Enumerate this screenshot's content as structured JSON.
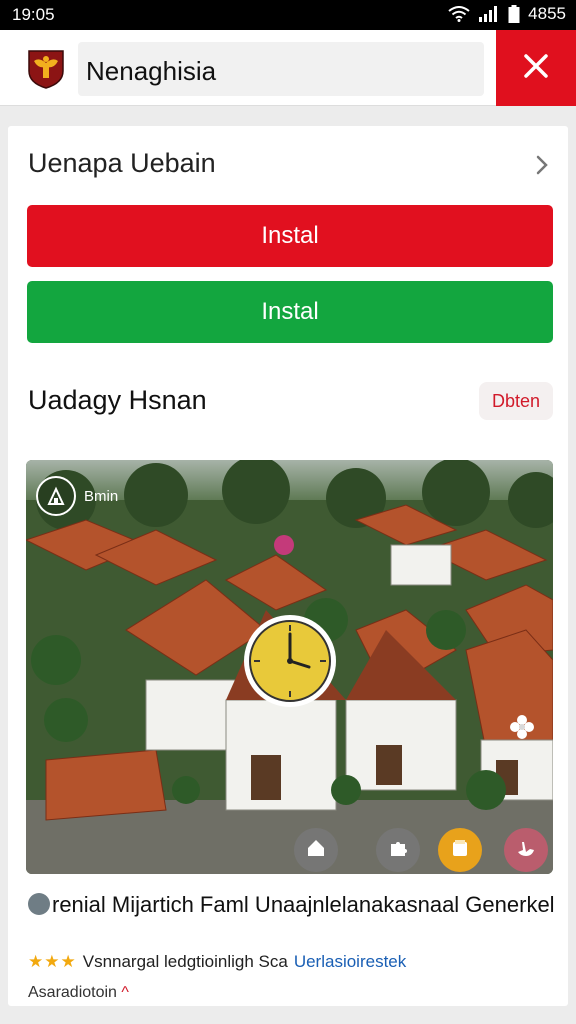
{
  "status_bar": {
    "time": "19:05",
    "battery_text": "4855"
  },
  "url_bar": {
    "title": "Nenaghisia"
  },
  "content": {
    "row_title": "Uenapa Uebain",
    "install_red": "Instal",
    "install_green": "Instal",
    "section_title": "Uadagy Hsnan",
    "section_action": "Dbten",
    "photo_badge": "Bmin",
    "caption_title": "renial Mijartich Faml Unaajnlelanakasnaal Generkel",
    "meta_text": "Vsnnargal ledgtioinligh Sca",
    "meta_link": "Uerlasioirestek",
    "footer_text": "Asaradiotoin"
  },
  "colors": {
    "accent_red": "#e1101f",
    "accent_green": "#13a63f",
    "link": "#1a5fb4"
  }
}
